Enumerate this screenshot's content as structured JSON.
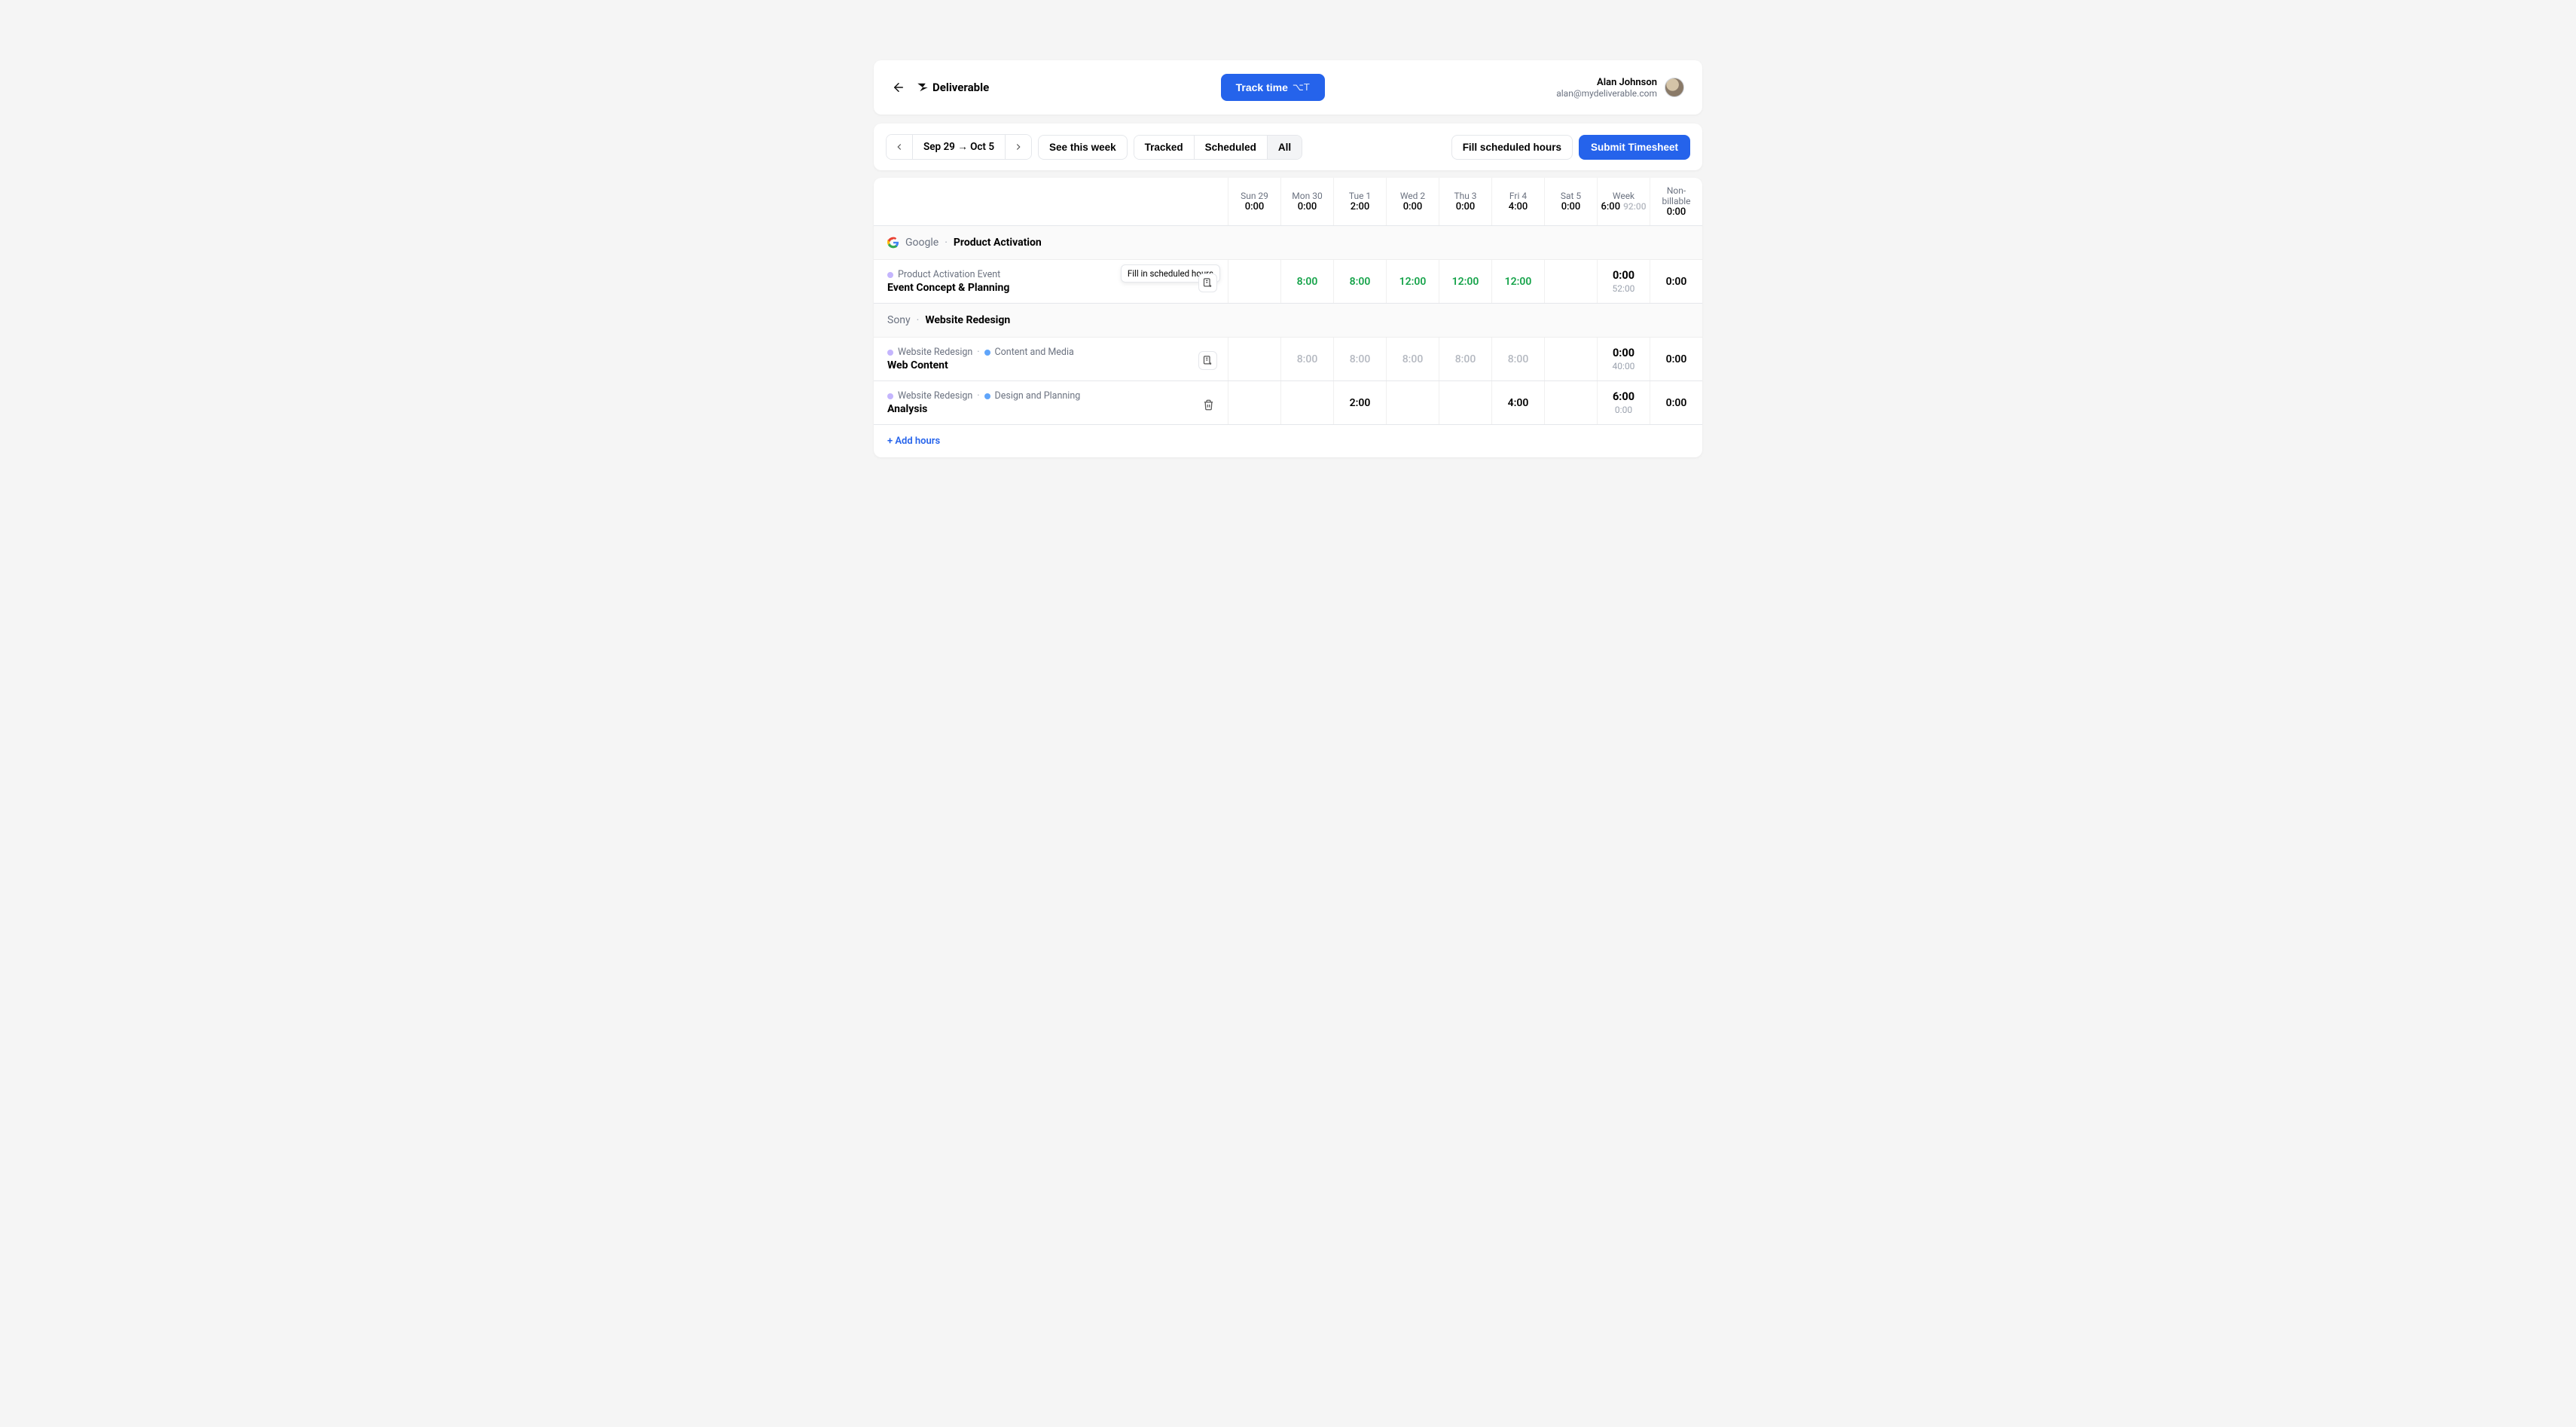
{
  "header": {
    "brand": "Deliverable",
    "track_label": "Track time",
    "track_shortcut": "⌥T",
    "user_name": "Alan Johnson",
    "user_email": "alan@mydeliverable.com"
  },
  "toolbar": {
    "date_range": "Sep 29 → Oct 5",
    "see_week": "See this week",
    "seg_tracked": "Tracked",
    "seg_scheduled": "Scheduled",
    "seg_all": "All",
    "fill_hours": "Fill scheduled hours",
    "submit": "Submit Timesheet"
  },
  "columns": {
    "days": [
      {
        "label": "Sun 29",
        "total": "0:00"
      },
      {
        "label": "Mon 30",
        "total": "0:00"
      },
      {
        "label": "Tue 1",
        "total": "2:00"
      },
      {
        "label": "Wed 2",
        "total": "0:00"
      },
      {
        "label": "Thu 3",
        "total": "0:00"
      },
      {
        "label": "Fri 4",
        "total": "4:00"
      },
      {
        "label": "Sat 5",
        "total": "0:00"
      }
    ],
    "week_label": "Week",
    "week_total": "6:00",
    "week_scheduled": "92:00",
    "nonbill_label": "Non-billable",
    "nonbill_total": "0:00"
  },
  "groups": [
    {
      "client": "Google",
      "project": "Product Activation",
      "icon": "google",
      "rows": [
        {
          "project_tag": "Product Activation Event",
          "category": null,
          "title": "Event Concept & Planning",
          "tooltip": "Fill in scheduled hours",
          "action_icon": "fill",
          "hours": [
            "",
            "8:00",
            "8:00",
            "12:00",
            "12:00",
            "12:00",
            ""
          ],
          "style": "green",
          "week_main": "0:00",
          "week_sub": "52:00",
          "nonbill": "0:00"
        }
      ]
    },
    {
      "client": "Sony",
      "project": "Website Redesign",
      "icon": null,
      "rows": [
        {
          "project_tag": "Website Redesign",
          "category": "Content and Media",
          "title": "Web Content",
          "tooltip": null,
          "action_icon": "fill",
          "hours": [
            "",
            "8:00",
            "8:00",
            "8:00",
            "8:00",
            "8:00",
            ""
          ],
          "style": "gray",
          "week_main": "0:00",
          "week_sub": "40:00",
          "nonbill": "0:00"
        },
        {
          "project_tag": "Website Redesign",
          "category": "Design and Planning",
          "title": "Analysis",
          "tooltip": null,
          "action_icon": "trash",
          "hours": [
            "",
            "",
            "2:00",
            "",
            "",
            "4:00",
            ""
          ],
          "style": "normal",
          "week_main": "6:00",
          "week_sub": "0:00",
          "nonbill": "0:00"
        }
      ]
    }
  ],
  "add_hours": "+ Add hours"
}
